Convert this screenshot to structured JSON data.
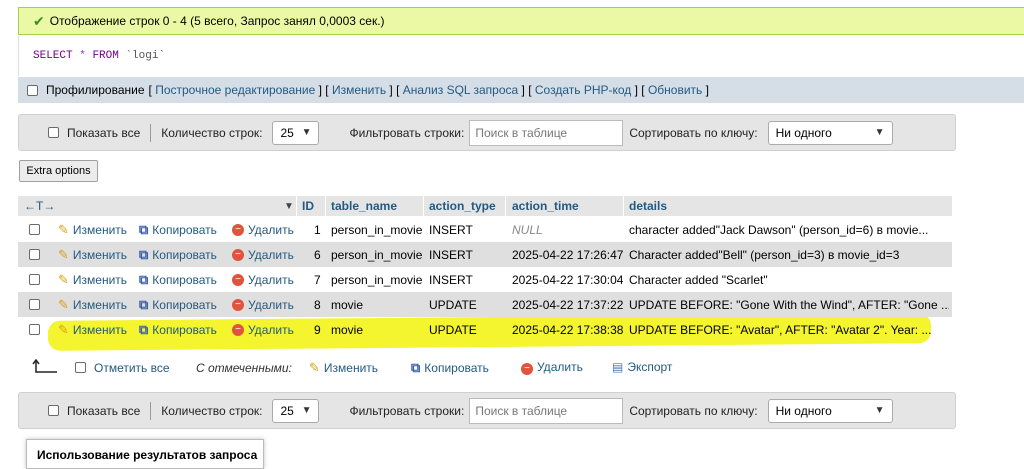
{
  "status": {
    "message": "Отображение строк 0 - 4 (5 всего, Запрос занял 0,0003 сек.)"
  },
  "sql": {
    "keyword_select": "SELECT",
    "star": "*",
    "keyword_from": "FROM",
    "table": "`logi`"
  },
  "query_links": {
    "profiling": "Профилирование",
    "inline_edit": "Построчное редактирование",
    "edit": "Изменить",
    "analyze": "Анализ SQL запроса",
    "create_php": "Создать PHP-код",
    "refresh": "Обновить"
  },
  "nav": {
    "show_all": "Показать все",
    "rows_label": "Количество строк:",
    "rows_value": "25",
    "filter_label": "Фильтровать строки:",
    "filter_placeholder": "Поиск в таблице",
    "sort_label": "Сортировать по ключу:",
    "sort_value": "Ни одного"
  },
  "extra_options": "Extra options",
  "table": {
    "columns": [
      "ID",
      "table_name",
      "action_type",
      "action_time",
      "details"
    ],
    "actions": {
      "edit": "Изменить",
      "copy": "Копировать",
      "delete": "Удалить"
    },
    "rows": [
      {
        "id": "1",
        "table_name": "person_in_movie",
        "action_type": "INSERT",
        "action_time": "NULL",
        "details": "character added\"Jack Dawson\" (person_id=6) в movie..."
      },
      {
        "id": "6",
        "table_name": "person_in_movie",
        "action_type": "INSERT",
        "action_time": "2025-04-22 17:26:47",
        "details": "Character added\"Bell\" (person_id=3) в movie_id=3"
      },
      {
        "id": "7",
        "table_name": "person_in_movie",
        "action_type": "INSERT",
        "action_time": "2025-04-22 17:30:04",
        "details": "Character added \"Scarlet\""
      },
      {
        "id": "8",
        "table_name": "movie",
        "action_type": "UPDATE",
        "action_time": "2025-04-22 17:37:22",
        "details": "UPDATE BEFORE: \"Gone With the Wind\", AFTER: \"Gone ..."
      },
      {
        "id": "9",
        "table_name": "movie",
        "action_type": "UPDATE",
        "action_time": "2025-04-22 17:38:38",
        "details": "UPDATE BEFORE: \"Avatar\", AFTER: \"Avatar 2\". Year: ..."
      }
    ]
  },
  "bulk": {
    "check_all": "Отметить все",
    "with_selected": "С отмеченными:",
    "edit": "Изменить",
    "copy": "Копировать",
    "delete": "Удалить",
    "export": "Экспорт"
  },
  "popup_text": "Использование результатов запроса"
}
